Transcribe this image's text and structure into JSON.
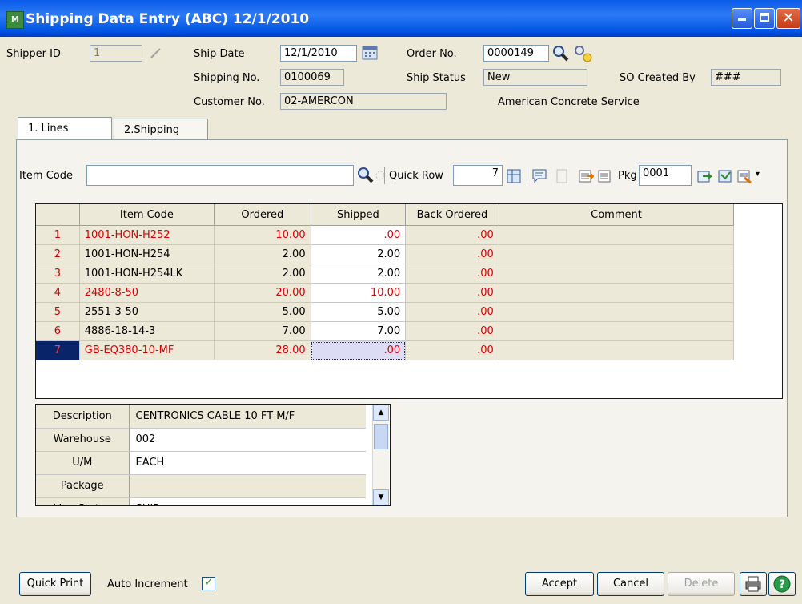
{
  "window": {
    "title": "Shipping Data Entry (ABC) 12/1/2010",
    "app_icon_text": "M"
  },
  "header": {
    "shipper_id_label": "Shipper ID",
    "shipper_id_value": "1",
    "ship_date_label": "Ship Date",
    "ship_date_value": "12/1/2010",
    "order_no_label": "Order No.",
    "order_no_value": "0000149",
    "shipping_no_label": "Shipping No.",
    "shipping_no_value": "0100069",
    "ship_status_label": "Ship Status",
    "ship_status_value": "New",
    "so_created_by_label": "SO Created By",
    "so_created_by_value": "###",
    "customer_no_label": "Customer No.",
    "customer_no_value": "02-AMERCON",
    "customer_name": "American Concrete Service"
  },
  "tabs": [
    {
      "label": "1. Lines"
    },
    {
      "label": "2.Shipping"
    }
  ],
  "toolbar": {
    "item_code_label": "Item Code",
    "item_code_value": "",
    "quick_row_label": "Quick Row",
    "quick_row_value": "7",
    "pkg_label": "Pkg",
    "pkg_value": "0001"
  },
  "grid": {
    "columns": [
      "Item Code",
      "Ordered",
      "Shipped",
      "Back Ordered",
      "Comment"
    ],
    "rows": [
      {
        "num": "1",
        "item": "1001-HON-H252",
        "ordered": "10.00",
        "shipped": ".00",
        "back": ".00",
        "comment": "",
        "red": true
      },
      {
        "num": "2",
        "item": "1001-HON-H254",
        "ordered": "2.00",
        "shipped": "2.00",
        "back": ".00",
        "comment": "",
        "red": false
      },
      {
        "num": "3",
        "item": "1001-HON-H254LK",
        "ordered": "2.00",
        "shipped": "2.00",
        "back": ".00",
        "comment": "",
        "red": false
      },
      {
        "num": "4",
        "item": "2480-8-50",
        "ordered": "20.00",
        "shipped": "10.00",
        "back": ".00",
        "comment": "",
        "red": true
      },
      {
        "num": "5",
        "item": "2551-3-50",
        "ordered": "5.00",
        "shipped": "5.00",
        "back": ".00",
        "comment": "",
        "red": false
      },
      {
        "num": "6",
        "item": "4886-18-14-3",
        "ordered": "7.00",
        "shipped": "7.00",
        "back": ".00",
        "comment": "",
        "red": false
      },
      {
        "num": "7",
        "item": "GB-EQ380-10-MF",
        "ordered": "28.00",
        "shipped": ".00",
        "back": ".00",
        "comment": "",
        "red": true
      }
    ]
  },
  "detail": {
    "rows": [
      {
        "label": "Description",
        "value": "CENTRONICS CABLE 10 FT M/F"
      },
      {
        "label": "Warehouse",
        "value": "002"
      },
      {
        "label": "U/M",
        "value": "EACH"
      },
      {
        "label": "Package",
        "value": ""
      },
      {
        "label": "Line Status",
        "value": "SHIP"
      }
    ]
  },
  "footer": {
    "quick_print": "Quick Print",
    "auto_increment_label": "Auto Increment",
    "accept": "Accept",
    "cancel": "Cancel",
    "delete": "Delete"
  },
  "colors": {
    "title_blue": "#0054e3",
    "row_red": "#e00000",
    "selected_row": "#0a246a"
  }
}
